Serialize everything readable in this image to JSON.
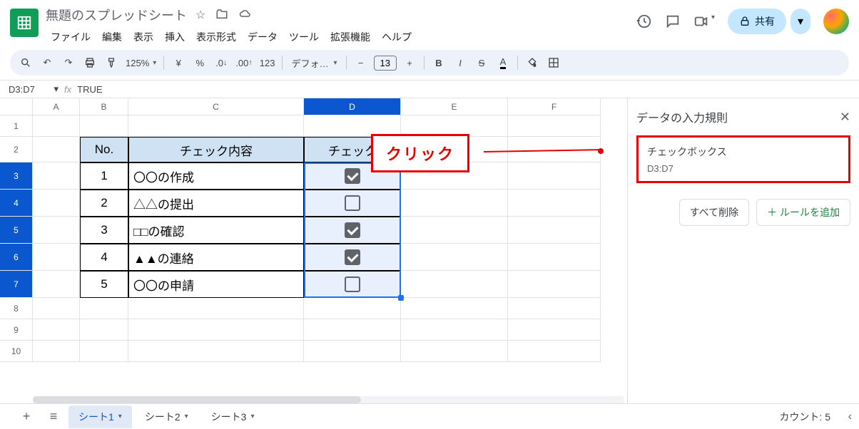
{
  "doc": {
    "title": "無題のスプレッドシート"
  },
  "menu": [
    "ファイル",
    "編集",
    "表示",
    "挿入",
    "表示形式",
    "データ",
    "ツール",
    "拡張機能",
    "ヘルプ"
  ],
  "share_label": "共有",
  "toolbar": {
    "zoom": "125%",
    "currency": "¥",
    "percent": "%",
    "dec_dec": ".0",
    "inc_dec": ".00",
    "numfmt": "123",
    "font": "デフォ…",
    "font_size": "13"
  },
  "formula": {
    "ref": "D3:D7",
    "value": "TRUE"
  },
  "columns": [
    "A",
    "B",
    "C",
    "D",
    "E",
    "F"
  ],
  "row_numbers": [
    1,
    2,
    3,
    4,
    5,
    6,
    7,
    8,
    9,
    10
  ],
  "table": {
    "headers": {
      "no": "No.",
      "content": "チェック内容",
      "check": "チェック"
    },
    "rows": [
      {
        "no": "1",
        "content": "〇〇の作成",
        "checked": true
      },
      {
        "no": "2",
        "content": "△△の提出",
        "checked": false
      },
      {
        "no": "3",
        "content": "□□の確認",
        "checked": true
      },
      {
        "no": "4",
        "content": "▲▲の連絡",
        "checked": true
      },
      {
        "no": "5",
        "content": "〇〇の申請",
        "checked": false
      }
    ]
  },
  "sidebar": {
    "title": "データの入力規則",
    "rule_type": "チェックボックス",
    "rule_range": "D3:D7",
    "delete_all": "すべて削除",
    "add_rule_prefix": "＋ ",
    "add_rule": "ルールを追加"
  },
  "annotation": {
    "label": "クリック"
  },
  "tabs": {
    "sheets": [
      "シート1",
      "シート2",
      "シート3"
    ],
    "active": 0
  },
  "status": {
    "count_label": "カウント: 5"
  }
}
